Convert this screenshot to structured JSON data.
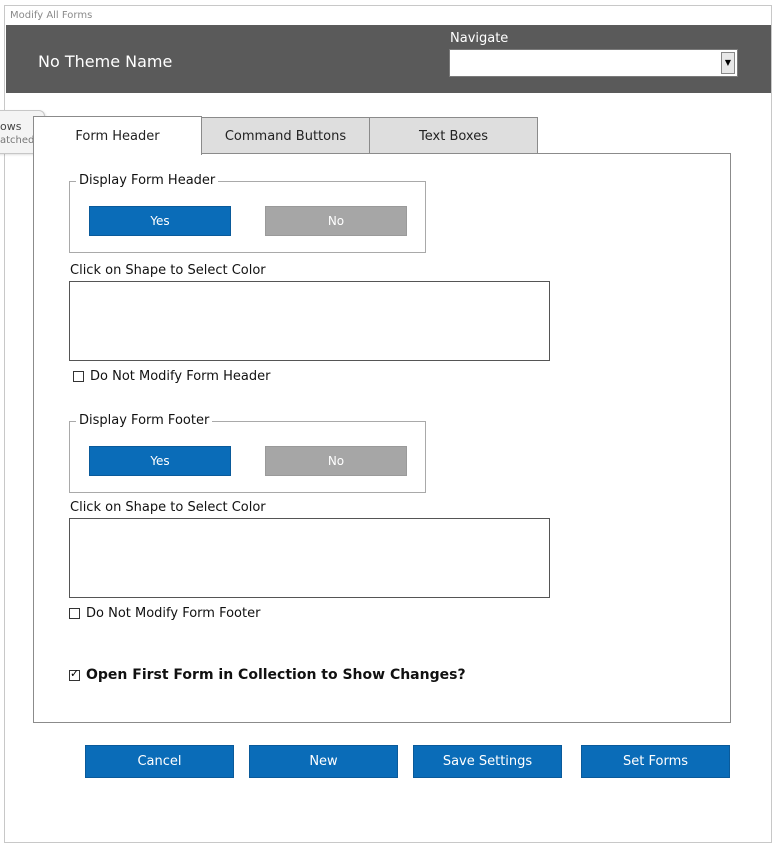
{
  "window": {
    "title": "Modify All Forms"
  },
  "header": {
    "theme_name": "No Theme Name",
    "navigate_label": "Navigate",
    "navigate_value": ""
  },
  "side_tab": {
    "line1": "ows",
    "line2": "atched"
  },
  "tabs": [
    {
      "label": "Form Header",
      "active": true
    },
    {
      "label": "Command Buttons",
      "active": false
    },
    {
      "label": "Text Boxes",
      "active": false
    }
  ],
  "form_header_section": {
    "display_legend": "Display Form Header",
    "yes_label": "Yes",
    "no_label": "No",
    "color_label": "Click on Shape to Select Color",
    "do_not_modify_label": "Do Not Modify Form Header",
    "do_not_modify_checked": false
  },
  "form_footer_section": {
    "display_legend": "Display Form Footer",
    "yes_label": "Yes",
    "no_label": "No",
    "color_label": "Click on Shape to Select Color",
    "do_not_modify_label": "Do Not Modify Form Footer",
    "do_not_modify_checked": false
  },
  "open_first_form": {
    "label": "Open First Form in Collection to Show Changes?",
    "checked": true
  },
  "actions": {
    "cancel": "Cancel",
    "new": "New",
    "save_settings": "Save Settings",
    "set_forms": "Set Forms"
  },
  "colors": {
    "accent_blue": "#0a6cb8",
    "header_gray": "#5a5a5a",
    "disabled_gray": "#a6a6a6"
  }
}
